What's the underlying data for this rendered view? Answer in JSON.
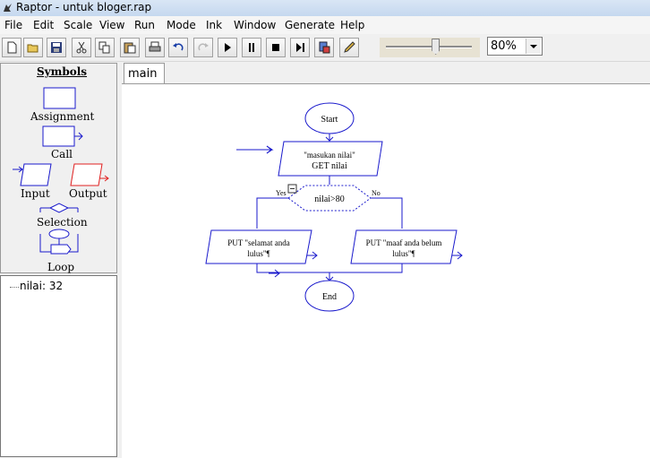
{
  "window": {
    "title": "Raptor - untuk bloger.rap"
  },
  "menu": [
    "File",
    "Edit",
    "Scale",
    "View",
    "Run",
    "Mode",
    "Ink",
    "Window",
    "Generate",
    "Help"
  ],
  "toolbar": {
    "buttons": [
      "new-file-icon",
      "open-folder-icon",
      "save-icon",
      "cut-icon",
      "copy-icon",
      "paste-icon",
      "print-icon",
      "undo-icon",
      "redo-icon",
      "play-icon",
      "pause-icon",
      "stop-icon",
      "step-icon",
      "test-server-icon",
      "pen-icon"
    ],
    "speed_level": 0.58,
    "zoom": "80%"
  },
  "symbols": {
    "title": "Symbols",
    "assignment": "Assignment",
    "call": "Call",
    "input": "Input",
    "output": "Output",
    "selection": "Selection",
    "loop": "Loop"
  },
  "watch": {
    "variables": [
      {
        "text": "nilai: 32"
      }
    ]
  },
  "tabs": [
    {
      "label": "main"
    }
  ],
  "flowchart": {
    "start": "Start",
    "input_prompt": "\"masukan nilai\"",
    "input_get": "GET nilai",
    "condition": "nilai>80",
    "yes": "Yes",
    "no": "No",
    "output_yes_line1": "PUT \"selamat anda",
    "output_yes_line2": "lulus\"¶",
    "output_no_line1": "PUT \"maaf anda belum",
    "output_no_line2": "lulus\"¶",
    "end": "End"
  },
  "colors": {
    "flow": "#1a1acc",
    "output_symbol": "#e02020",
    "titlebar": "#c5d8ef"
  }
}
